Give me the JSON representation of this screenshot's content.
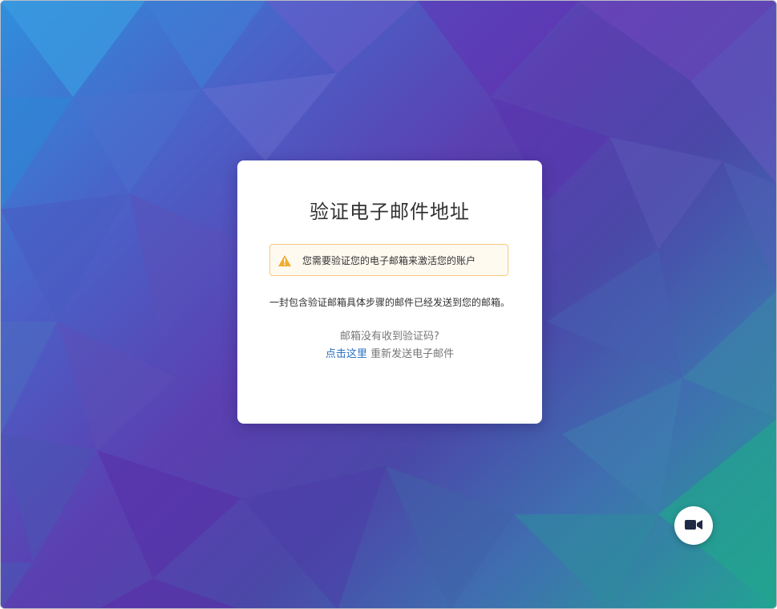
{
  "card": {
    "title": "验证电子邮件地址",
    "alert": {
      "icon": "warning-icon",
      "text": "您需要验证您的电子邮箱来激活您的账户",
      "border_color": "#f5c97b",
      "icon_color": "#f0ad2e"
    },
    "description": "一封包含验证邮箱具体步骤的邮件已经发送到您的邮箱。",
    "question": "邮箱没有收到验证码?",
    "resend_link": "点击这里",
    "resend_suffix": " 重新发送电子邮件",
    "link_color": "#2a6fc4"
  },
  "floating_button": {
    "icon": "video-camera-icon"
  }
}
